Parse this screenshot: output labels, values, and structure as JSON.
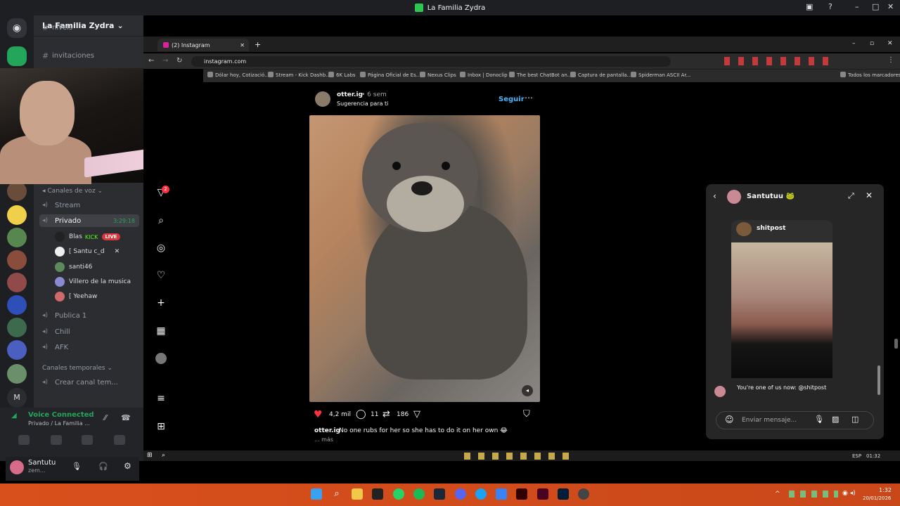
{
  "titlebar": {
    "title": "La Familia Zydra"
  },
  "discord": {
    "guild_name": "La Familia Zydra",
    "channels_top": [
      {
        "label": "nivels"
      },
      {
        "label": "invitaciones"
      }
    ],
    "voice_category": "Canales de voz",
    "voice_channels": [
      {
        "label": "Stream"
      },
      {
        "label": "Privado",
        "timer": "3:29:18"
      }
    ],
    "voice_users": [
      {
        "name": "Blas",
        "extra": "KICK",
        "badge": "LIVE"
      },
      {
        "name": "[ Santu c_d"
      },
      {
        "name": "santi46"
      },
      {
        "name": "Villero de la musica"
      },
      {
        "name": "[ Yeehaw"
      }
    ],
    "voice_channels_more": [
      {
        "label": "Publica 1"
      },
      {
        "label": "Chill"
      },
      {
        "label": "AFK"
      }
    ],
    "temp_category": "Canales temporales",
    "temp_channel": "Crear canal tem...",
    "voice_status": "Voice Connected",
    "voice_location": "Privado / La Familia ...",
    "user_name": "Santutu",
    "user_status": "zem..."
  },
  "browser": {
    "tab_label": "(2) Instagram",
    "url": "instagram.com",
    "bookmarks": [
      "Dólar hoy, Cotizació...",
      "Stream - Kick Dashb...",
      "6K Labs",
      "Página Oficial de Es...",
      "Nexus Clips",
      "Inbox | Donoclip",
      "The best ChatBot an...",
      "Captura de pantalla...",
      "Spiderman ASCII Ar...",
      "Todos los marcadores"
    ]
  },
  "post": {
    "username": "otter.ig",
    "age": "• 6 sem",
    "subtitle": "Sugerencia para ti",
    "follow": "Seguir",
    "likes": "4,2 mil",
    "comments": "11",
    "reposts": "186",
    "caption_user": "otter.ig",
    "caption_text": "No one rubs for her so she has to do it on her own 😂",
    "more": "... más"
  },
  "dm": {
    "contact": "Santutuu 🐸",
    "shared_from": "shitpost",
    "message": "You're one of us now: @shitpost",
    "input_placeholder": "Enviar mensaje..."
  },
  "tray": {
    "lang": "ESP",
    "time_small": "01:32",
    "time": "1:32",
    "date": "20/01/2026"
  },
  "notifications": {
    "ig_badge": "2"
  }
}
